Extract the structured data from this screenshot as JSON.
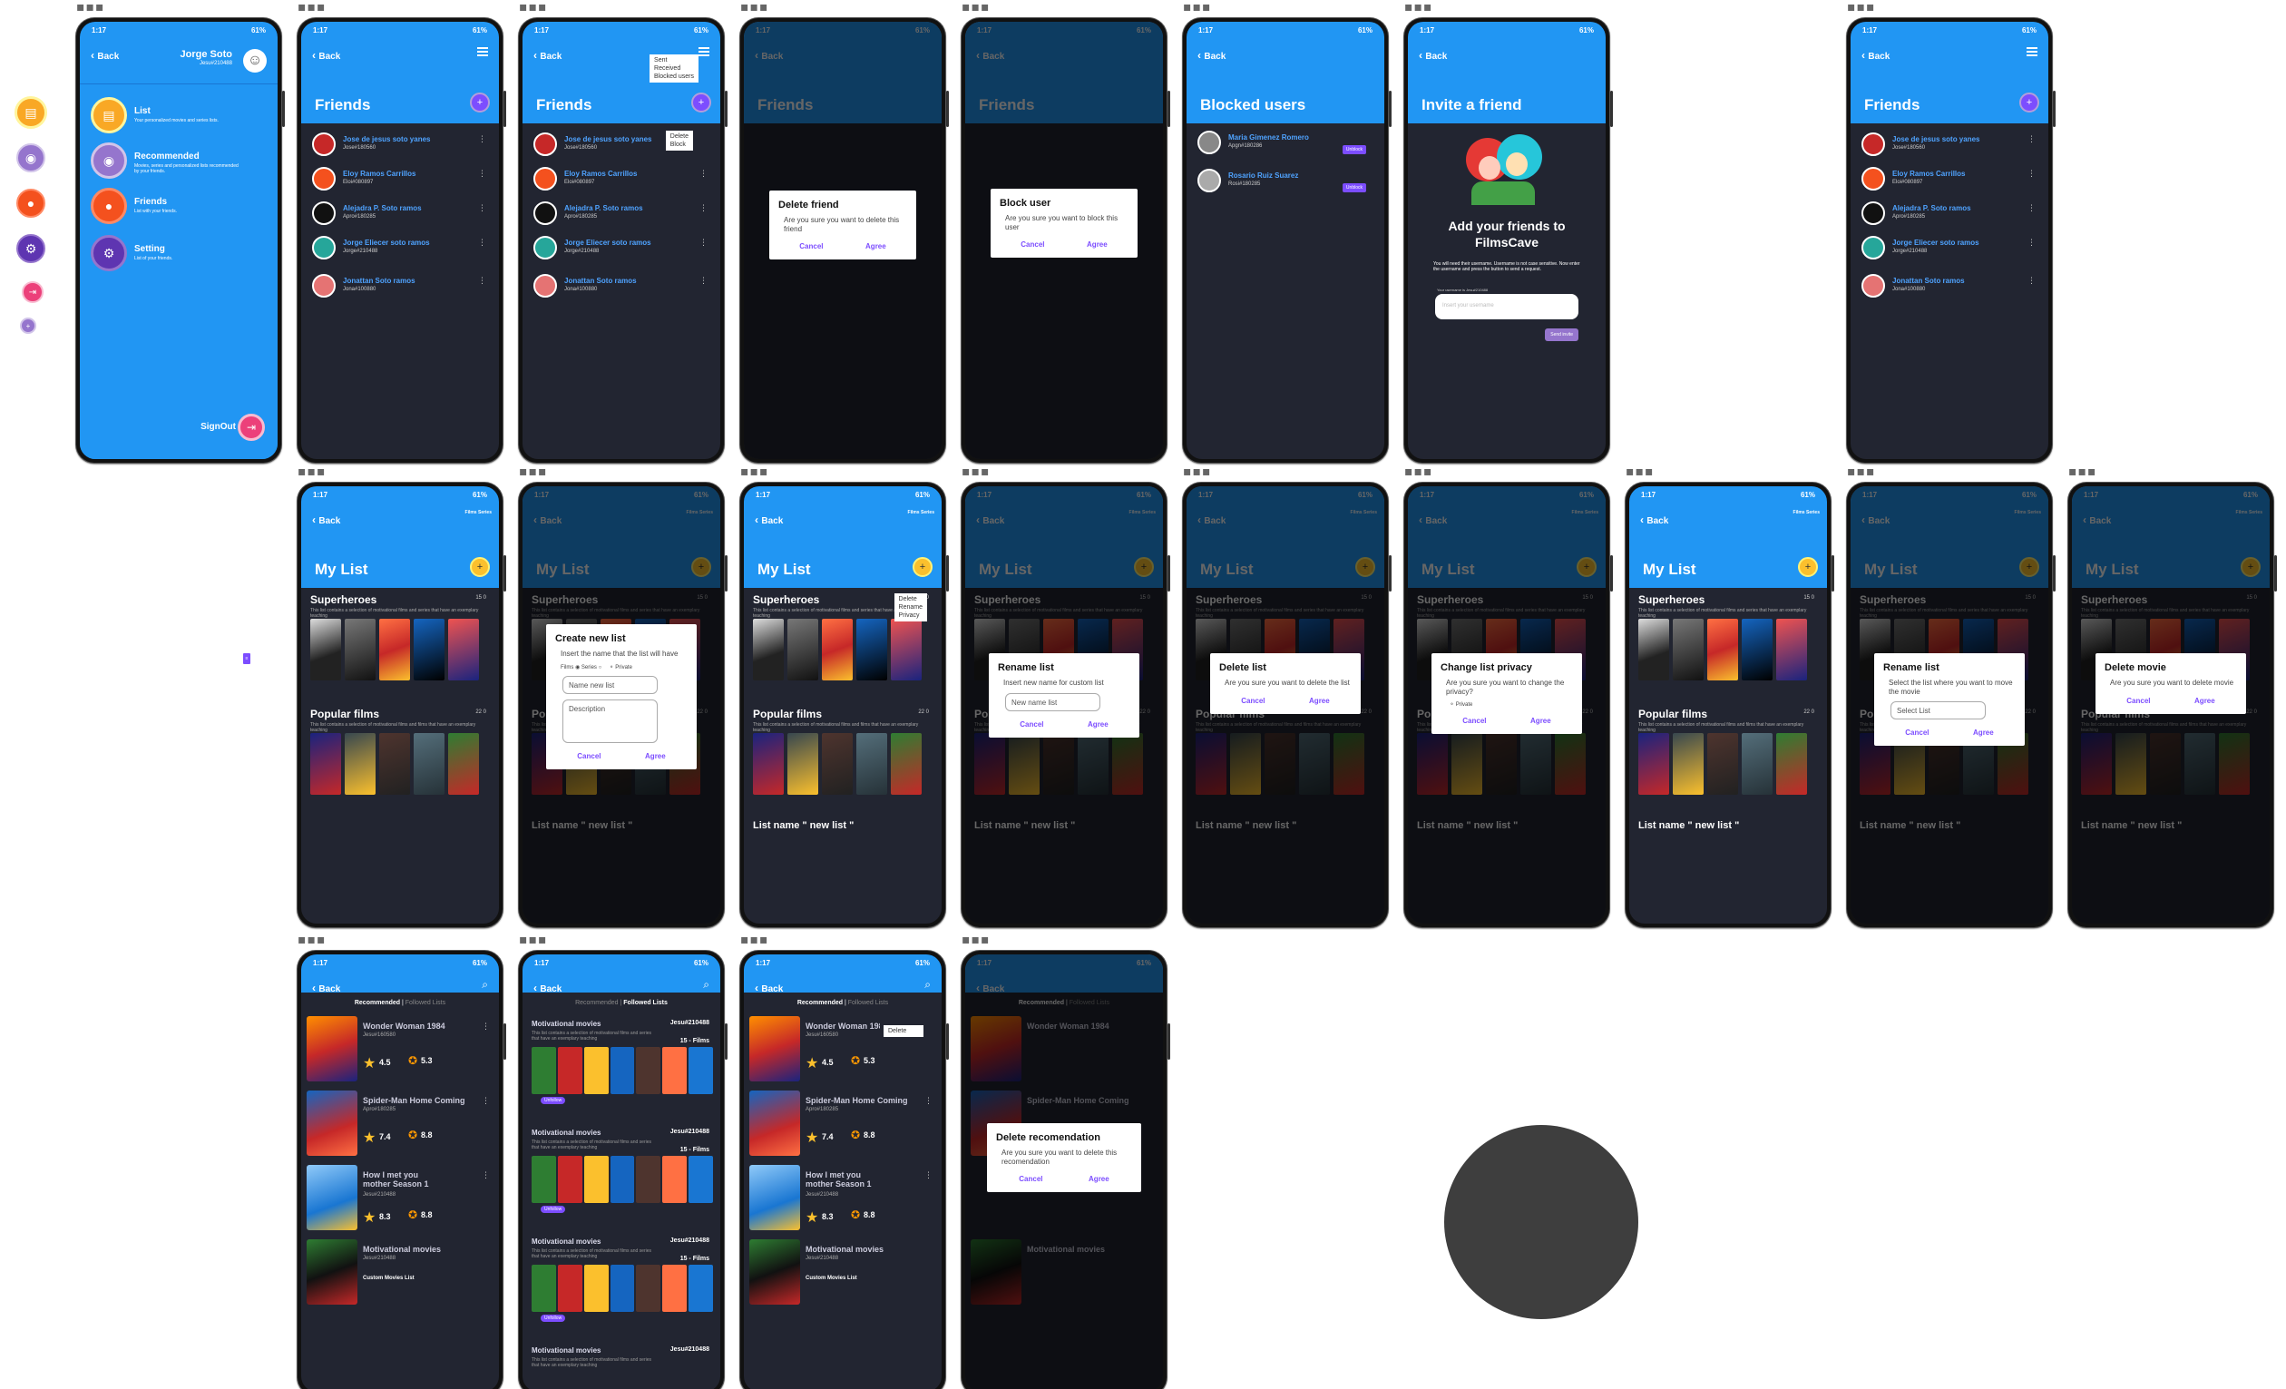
{
  "status": {
    "time": "1:17",
    "battery": "61%"
  },
  "common": {
    "back": "Back",
    "cancel": "Cancel",
    "agree": "Agree",
    "dots": "•••"
  },
  "menu": {
    "user_name": "Jorge Soto",
    "user_id": "Jesu#210488",
    "items": [
      {
        "label": "List",
        "desc": "Your personalized movies and series lists."
      },
      {
        "label": "Recommended",
        "desc": "Movies, series and personalized lists recommended by your friends."
      },
      {
        "label": "Friends",
        "desc": "List with your friends."
      },
      {
        "label": "Setting",
        "desc": "List of your friends."
      }
    ],
    "signout": "SignOut"
  },
  "friends": {
    "title": "Friends",
    "list": [
      {
        "name": "Jose de jesus soto yanes",
        "id": "Jose#180560"
      },
      {
        "name": "Eloy Ramos Carrillos",
        "id": "Eloi#080897"
      },
      {
        "name": "Alejadra P. Soto ramos",
        "id": "Apro#180285"
      },
      {
        "name": "Jorge Eliecer soto ramos",
        "id": "Jorge#210488"
      },
      {
        "name": "Jonattan Soto ramos",
        "id": "Jona#100880"
      }
    ],
    "menu_popup": [
      "Sent",
      "Received",
      "Blocked users"
    ],
    "row_popup": [
      "Delete",
      "Block"
    ]
  },
  "dialogs": {
    "delete_friend": {
      "title": "Delete friend",
      "body": "Are you sure you want to delete this friend"
    },
    "block_user": {
      "title": "Block user",
      "body": "Are you sure you want to block this user"
    },
    "create_list": {
      "title": "Create new list",
      "body": "Insert the name that the list will have",
      "films": "Films",
      "series": "Series",
      "private": "Private",
      "name_ph": "Name new list",
      "desc_ph": "Description"
    },
    "rename_list": {
      "title": "Rename list",
      "body": "Insert new name for custom list",
      "ph": "New name list"
    },
    "delete_list": {
      "title": "Delete list",
      "body": "Are you sure you want to delete the list"
    },
    "privacy": {
      "title": "Change list privacy",
      "body": "Are you sure you want to change the privacy?",
      "private": "Private"
    },
    "move_list": {
      "title": "Rename list",
      "body": "Select the list where you want to move the movie",
      "ph": "Select List"
    },
    "delete_movie": {
      "title": "Delete movie",
      "body": "Are you sure you want to delete movie"
    },
    "delete_rec": {
      "title": "Delete recomendation",
      "body": "Are you sure you want to delete this recomendation"
    }
  },
  "blocked": {
    "title": "Blocked users",
    "list": [
      {
        "name": "Maria Gimenez Romero",
        "id": "Apgn#180286",
        "btn": "Unblock"
      },
      {
        "name": "Rosario Ruiz Suarez",
        "id": "Rosi#180285",
        "btn": "Unblock"
      }
    ]
  },
  "invite": {
    "title": "Invite a friend",
    "heading": "Add your friends to FilmsCave",
    "body": "You will need their username. Username is not case sensitive. Now enter the username and press the button to send a request.",
    "label": "Your username is Jesu#210488",
    "placeholder": "Insert your username",
    "button": "Send invite"
  },
  "mylist": {
    "title": "My List",
    "toggle": [
      "Films",
      "Series"
    ],
    "sections": [
      {
        "title": "Superheroes",
        "desc": "This list contains a selection of motivational films and series that have an exemplary teaching",
        "count": "15   0"
      },
      {
        "title": "Popular films",
        "desc": "This list contains a selection of motivational films and films that have an exemplary teaching",
        "count": "22   0"
      }
    ],
    "new_list": "List name \" new list \"",
    "popup": [
      "Delete",
      "Rename",
      "Privacy"
    ]
  },
  "recommended": {
    "tabs": [
      "Recommended",
      "Followed Lists"
    ],
    "items": [
      {
        "title": "Wonder Woman 1984",
        "user": "Jesu#160580",
        "rating": "4.5",
        "score": "5.3"
      },
      {
        "title": "Spider-Man Home Coming",
        "user": "Apro#180285",
        "rating": "7.4",
        "score": "8.8"
      },
      {
        "title": "How I met you mother Season 1",
        "user": "Jesu#210488",
        "rating": "8.3",
        "score": "8.8"
      },
      {
        "title": "Motivational movies",
        "user": "Jesu#210488",
        "rating": "",
        "score": "",
        "tag": "Custom Movies List"
      }
    ],
    "popup_delete": "Delete",
    "followed": [
      {
        "title": "Motivational movies",
        "user": "Jesu#210488",
        "desc": "This list contains a selection of motivational films and series that have an exemplary teaching",
        "films": "15 - Films",
        "badge": "Unfollow"
      },
      {
        "title": "Motivational movies",
        "user": "Jesu#210488",
        "desc": "This list contains a selection of motivational films and series that have an exemplary teaching",
        "films": "15 - Films",
        "badge": "Unfollow"
      },
      {
        "title": "Motivational movies",
        "user": "Jesu#210488",
        "desc": "This list contains a selection of motivational films and series that have an exemplary teaching",
        "films": "15 - Films",
        "badge": "Unfollow"
      },
      {
        "title": "Motivational movies",
        "user": "Jesu#210488",
        "desc": "This list contains a selection of motivational films and series that have an exemplary teaching",
        "films": "",
        "badge": ""
      }
    ]
  },
  "colors": {
    "blue": "#2196f3",
    "purple": "#7c4dff",
    "dark": "#222531",
    "yellow": "#fbc02d"
  }
}
